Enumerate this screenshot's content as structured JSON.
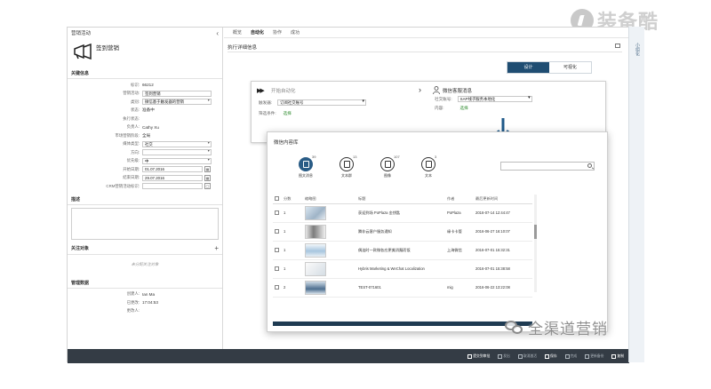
{
  "watermark": {
    "brand": "装备酷",
    "wechat": "全渠道营销"
  },
  "left_panel": {
    "header": "营销活动",
    "collapse": "‹",
    "title": "签到营销",
    "section_basic": "关键信息",
    "fields": {
      "id_label": "标识:",
      "id_value": "66212",
      "name_label": "营销活动:",
      "name_value": "签到营销",
      "type_label": "类别:",
      "type_value": "微信基于触发器的营销",
      "status_label": "状态:",
      "status_value": "准备中",
      "exec_label": "执行状态:",
      "exec_value": "",
      "owner_label": "负责人:",
      "owner_value": "Cathy Xu",
      "market_label": "市场营销阶段:",
      "market_value": "全局",
      "media_label": "媒体类型:",
      "media_value": "社交",
      "dir_label": "方向:",
      "dir_value": "",
      "prio_label": "优先级:",
      "prio_value": "中",
      "start_label": "开始日期:",
      "start_value": "01.07.2016",
      "end_label": "结束日期:",
      "end_value": "29.07.2016",
      "crm_label": "CRM营销活动标识:",
      "crm_value": ""
    },
    "section_notes": "描述",
    "section_targets": "关注对象",
    "targets_add": "+",
    "targets_empty": "未分配关注对象",
    "section_admin": "管理数据",
    "created_label": "创建人:",
    "created_value": "Ian Ma",
    "created_on_label": "已更改:",
    "created_on_value": "17:04:53",
    "changed_label": "更改人:",
    "changed_value": ""
  },
  "tabs": [
    "概览",
    "自动化",
    "协作",
    "成功"
  ],
  "active_tab": "自动化",
  "panel_title": "执行详细信息",
  "segment": {
    "left": "设计",
    "right": "可视化"
  },
  "flow": {
    "trigger_title": "开始自动化",
    "trigger_field_label": "触发器:",
    "trigger_field_value": "订阅社交账号",
    "cond_label": "筛选条件:",
    "cond_link": "选择",
    "action_title": "微信客服消息",
    "action_account_label": "社交账号:",
    "action_account_value": "SAP线子服务本地化",
    "action_content_label": "内容:",
    "action_content_link": "选择"
  },
  "dialog": {
    "title": "微信内容库",
    "types": [
      {
        "label": "图文消息",
        "count": "39"
      },
      {
        "label": "文本群",
        "count": "13"
      },
      {
        "label": "图像",
        "count": "107"
      },
      {
        "label": "文本",
        "count": "3"
      }
    ],
    "search_placeholder": "",
    "columns": [
      "分数",
      "缩略图",
      "标题",
      "作者",
      "最后更新时间"
    ],
    "rows": [
      {
        "score": "1",
        "title": "获迎到场 PoPlaza 金钥匙",
        "author": "PoPlaza",
        "date": "2016-07-14 12:44:47"
      },
      {
        "score": "1",
        "title": "腾非云客户服务通知",
        "author": "缘卡卡管",
        "date": "2016-06-27 16:10:07"
      },
      {
        "score": "1",
        "title": "偶连时一款微各应更美消麵而饭",
        "author": "上海微信",
        "date": "2016-07-01 15:32:31"
      },
      {
        "score": "1",
        "title": "Hybris Marketing & WeChat Localization",
        "author": "",
        "date": "2016-07-01 15:38:58"
      },
      {
        "score": "2",
        "title": "TEST-071601",
        "author": "mig",
        "date": "2016-06-22 13:22:08"
      }
    ]
  },
  "bottom_bar": {
    "buttons": [
      {
        "label": "提交到审批",
        "strong": true
      },
      {
        "label": "发出",
        "strong": false
      },
      {
        "label": "取消激活",
        "strong": false
      },
      {
        "label": "保存",
        "strong": true
      },
      {
        "label": "完成",
        "strong": false
      },
      {
        "label": "更新备份",
        "strong": false
      },
      {
        "label": "复制",
        "strong": true
      }
    ]
  },
  "side_strip": {
    "label": "小组化"
  },
  "colors": {
    "accent": "#1f4d72",
    "arrow": "#1f5a8a",
    "toolbar": "#343c45",
    "link": "#2c8a2c"
  }
}
